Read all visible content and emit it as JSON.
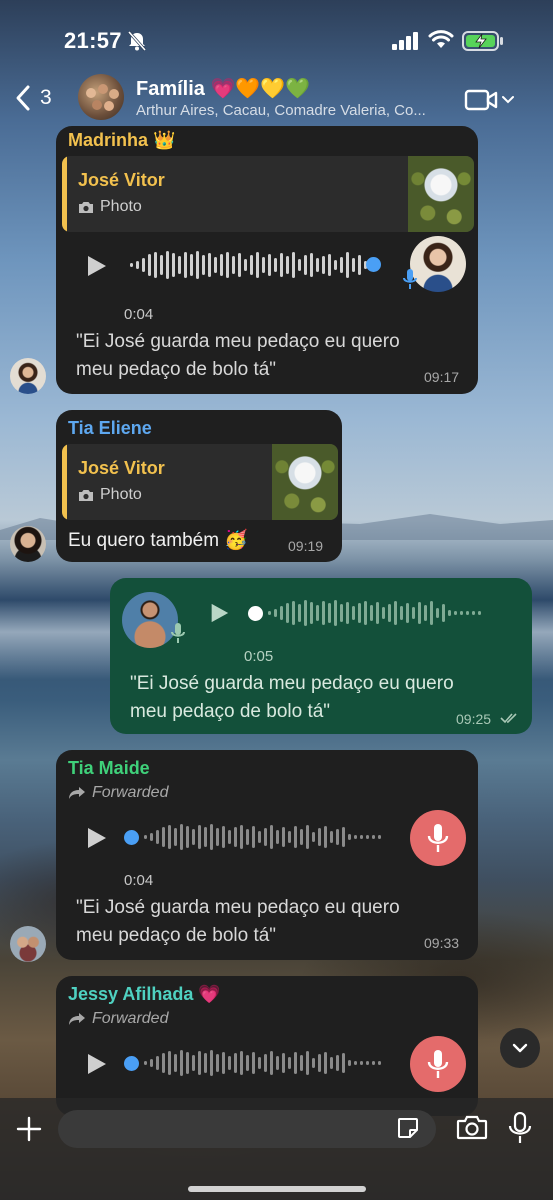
{
  "status_bar": {
    "time": "21:57"
  },
  "header": {
    "back_count": "3",
    "title": "Família 💗🧡💛💚",
    "subtitle": "Arthur Aires, Cacau, Comadre Valeria, Co..."
  },
  "messages": [
    {
      "sender": "Madrinha 👑",
      "reply": {
        "name": "José Vitor",
        "type": "Photo"
      },
      "duration": "0:04",
      "transcript_line1": "\"Ei José guarda meu pedaço eu quero",
      "transcript_line2": "meu pedaço de bolo tá\"",
      "time": "09:17"
    },
    {
      "sender": "Tia Eliene",
      "reply": {
        "name": "José Vitor",
        "type": "Photo"
      },
      "text": "Eu quero também 🥳",
      "time": "09:19"
    },
    {
      "duration": "0:05",
      "transcript_line1": "\"Ei José guarda meu pedaço eu quero",
      "transcript_line2": "meu pedaço de bolo tá\"",
      "time": "09:25"
    },
    {
      "sender": "Tia Maide",
      "forwarded": "Forwarded",
      "duration": "0:04",
      "transcript_line1": "\"Ei José guarda meu pedaço eu quero",
      "transcript_line2": "meu pedaço de bolo tá\"",
      "time": "09:33"
    },
    {
      "sender": "Jessy Afilhada 💗",
      "forwarded": "Forwarded"
    }
  ],
  "composer": {
    "placeholder": ""
  },
  "colors": {
    "sender_madrinha": "#f2c14e",
    "sender_eliene": "#5ea8f0",
    "sender_maide": "#3fd17a",
    "sender_jessy": "#4fd1c1",
    "outgoing_bubble": "#13503a",
    "incoming_bubble": "#1f1f1f",
    "record_button": "#e46b6b"
  }
}
